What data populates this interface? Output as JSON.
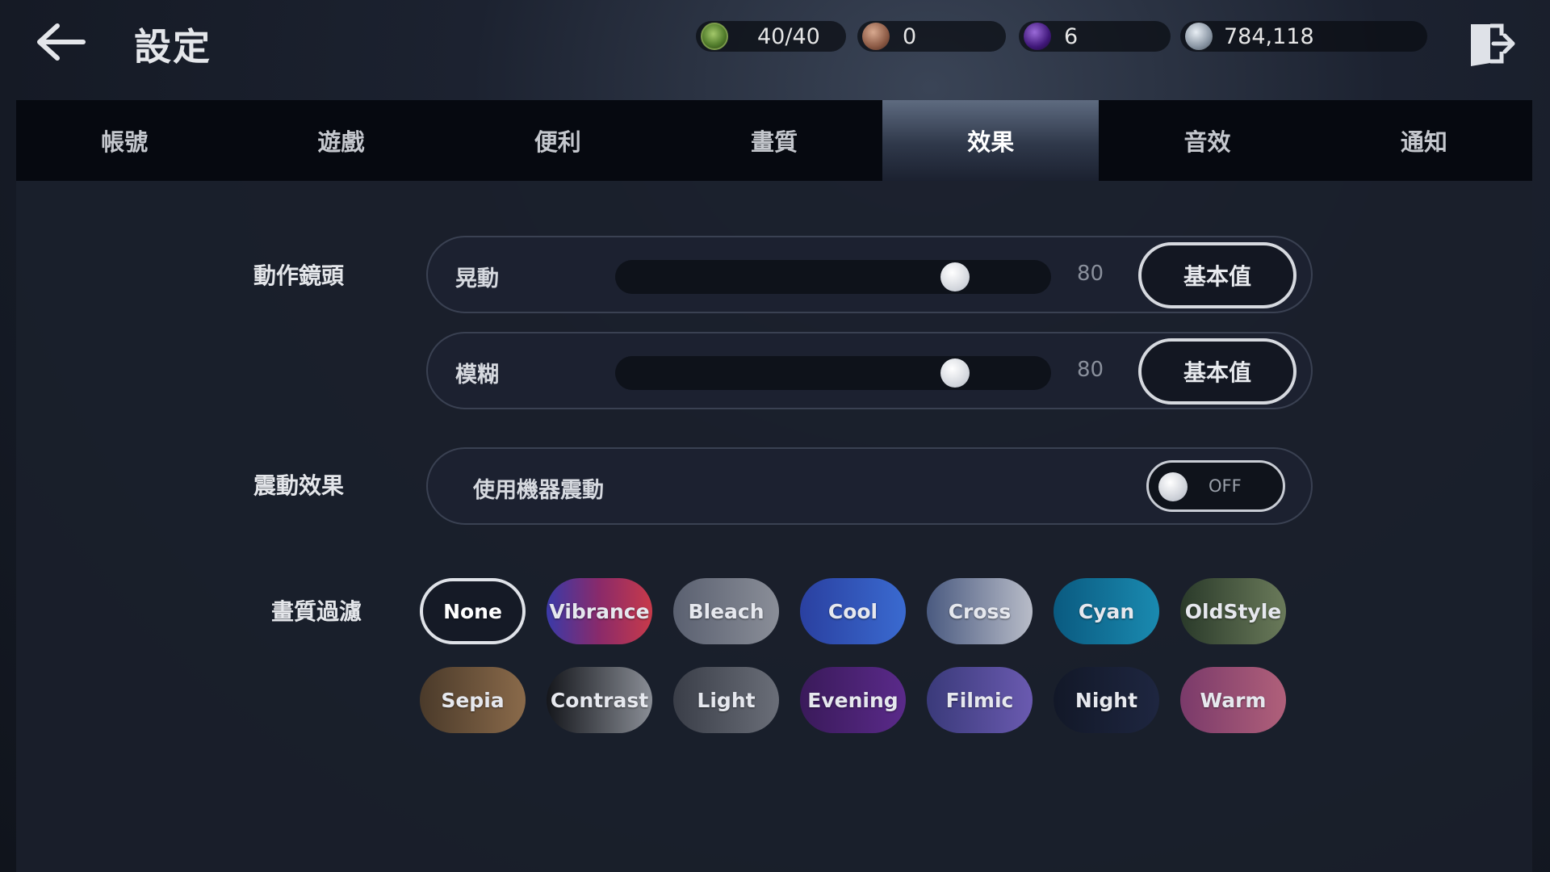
{
  "header": {
    "title": "設定",
    "resources": {
      "stamina": "40/40",
      "bronze": "0",
      "gem": "6",
      "silver": "784,118"
    }
  },
  "tabs": [
    {
      "label": "帳號",
      "active": false
    },
    {
      "label": "遊戲",
      "active": false
    },
    {
      "label": "便利",
      "active": false
    },
    {
      "label": "畫質",
      "active": false
    },
    {
      "label": "效果",
      "active": true
    },
    {
      "label": "音效",
      "active": false
    },
    {
      "label": "通知",
      "active": false
    }
  ],
  "camera": {
    "label": "動作鏡頭",
    "sliders": [
      {
        "name": "晃動",
        "value": "80",
        "fraction": 0.78,
        "default_label": "基本值"
      },
      {
        "name": "模糊",
        "value": "80",
        "fraction": 0.78,
        "default_label": "基本值"
      }
    ]
  },
  "vibration": {
    "label": "震動效果",
    "option": "使用機器震動",
    "state": "OFF"
  },
  "filters": {
    "label": "畫質過濾",
    "selected": "None",
    "rows": [
      [
        "None",
        "Vibrance",
        "Bleach",
        "Cool",
        "Cross",
        "Cyan",
        "OldStyle"
      ],
      [
        "Sepia",
        "Contrast",
        "Light",
        "Evening",
        "Filmic",
        "Night",
        "Warm"
      ]
    ],
    "colors": {
      "None": "#151a26",
      "Vibrance": "linear-gradient(90deg,#3a3aa8,#8a2a6a,#c83a4a)",
      "Bleach": "linear-gradient(90deg,#5a6070,#8a8e98)",
      "Cool": "linear-gradient(90deg,#2a40a0,#3a6ad0)",
      "Cross": "linear-gradient(90deg,#4a5a80,#b8bcc8)",
      "Cyan": "linear-gradient(90deg,#0a5a80,#1a8ab0)",
      "OldStyle": "linear-gradient(90deg,#2a3a2a,#6a7a5a)",
      "Sepia": "linear-gradient(90deg,#4a3a2a,#8a6a4a)",
      "Contrast": "linear-gradient(90deg,#15171c,#8a8e96)",
      "Light": "linear-gradient(90deg,#3a3e48,#6a6e78)",
      "Evening": "linear-gradient(90deg,#3a1a5a,#5a2a8a)",
      "Filmic": "linear-gradient(90deg,#3a3a7a,#6a5ab0)",
      "Night": "linear-gradient(90deg,#121828,#1e2640)",
      "Warm": "linear-gradient(90deg,#7a3a6a,#b0607a)"
    }
  }
}
